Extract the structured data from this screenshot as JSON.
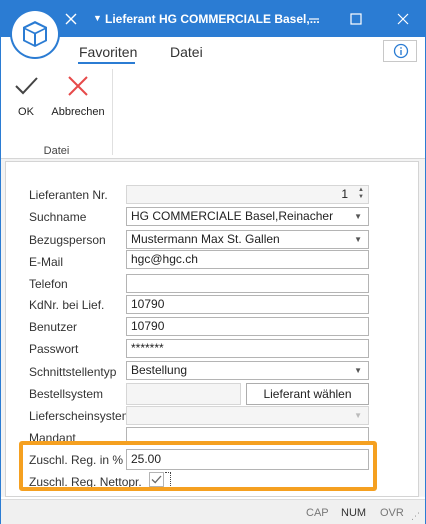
{
  "window": {
    "title": "Lieferant HG COMMERCIALE Basel,...",
    "accent": "#2b7cd3"
  },
  "ribbon": {
    "tabs": [
      "Favoriten",
      "Datei"
    ],
    "active_tab": "Favoriten",
    "ok_label": "OK",
    "cancel_label": "Abbrechen",
    "group_label": "Datei"
  },
  "form": {
    "lieferanten_nr": {
      "label": "Lieferanten Nr.",
      "value": "1"
    },
    "suchname": {
      "label": "Suchname",
      "value": "HG COMMERCIALE Basel,Reinacher"
    },
    "bezugsperson": {
      "label": "Bezugsperson",
      "value": "Mustermann Max St. Gallen"
    },
    "email": {
      "label": "E-Mail",
      "value": "hgc@hgc.ch"
    },
    "telefon": {
      "label": "Telefon",
      "value": ""
    },
    "kdnr": {
      "label": "KdNr. bei Lief.",
      "value": "10790"
    },
    "benutzer": {
      "label": "Benutzer",
      "value": "10790"
    },
    "passwort": {
      "label": "Passwort",
      "value": "*******"
    },
    "schnittstellentyp": {
      "label": "Schnittstellentyp",
      "value": "Bestellung"
    },
    "bestellsystem": {
      "label": "Bestellsystem",
      "value": "",
      "button": "Lieferant wählen"
    },
    "lieferscheinsystem": {
      "label": "Lieferscheinsystem",
      "value": ""
    },
    "mandant": {
      "label": "Mandant",
      "value": ""
    },
    "zuschlag": {
      "label": "Zuschl. Reg. in %",
      "value": "25.00"
    },
    "nettopr": {
      "label": "Zuschl. Reg. Nettopr.",
      "checked": true
    }
  },
  "highlight_color": "#f5a020",
  "status": {
    "cap": "CAP",
    "num": "NUM",
    "ovr": "OVR"
  }
}
